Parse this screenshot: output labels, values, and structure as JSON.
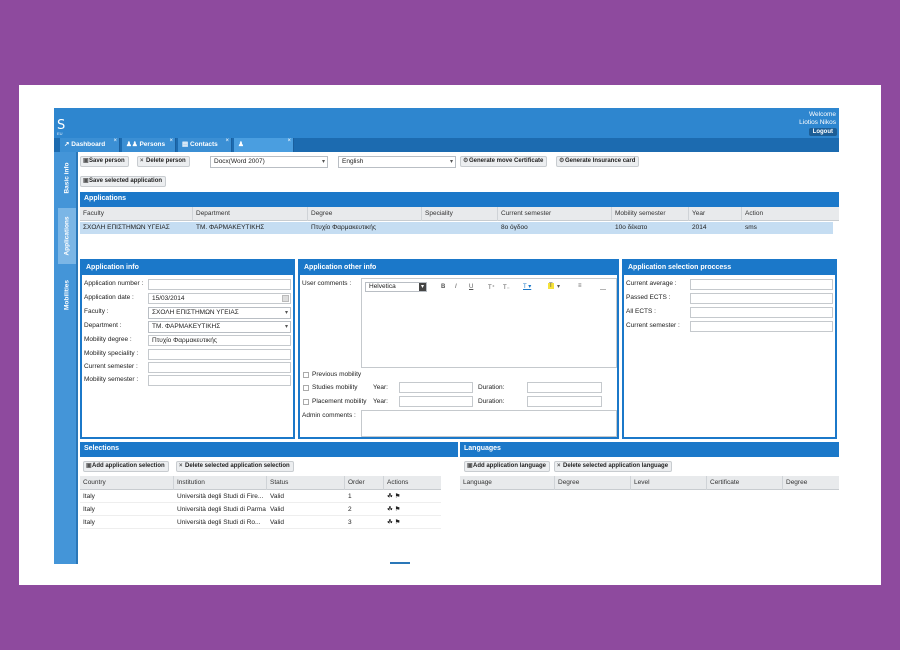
{
  "header": {
    "logo": "S",
    "logo_sub": "EU",
    "welcome": "Welcome",
    "user_name": "Liotios Nikos",
    "logout_label": "Logout"
  },
  "tabs": [
    {
      "label": "Dashboard",
      "icon": "chart-icon"
    },
    {
      "label": "Persons",
      "icon": "users-icon"
    },
    {
      "label": "Contacts",
      "icon": "contacts-icon"
    },
    {
      "label": "",
      "icon": "user-icon"
    }
  ],
  "sidenav": {
    "items": [
      "Basic info",
      "Applications",
      "Mobilities"
    ]
  },
  "toolbar": {
    "save_person": "Save person",
    "delete_person": "Delete person",
    "format_value": "Docx(Word 2007)",
    "language_value": "English",
    "gen_move_cert": "Generate move Certificate",
    "gen_insurance": "Generate Insurance card",
    "save_selected_application": "Save selected application"
  },
  "applications": {
    "title": "Applications",
    "columns": [
      "Faculty",
      "Department",
      "Degree",
      "Speciality",
      "Current semester",
      "Mobility semester",
      "Year",
      "Action"
    ],
    "rows": [
      [
        "ΣΧΟΛΗ ΕΠΙΣΤΗΜΩΝ ΥΓΕΙΑΣ",
        "ΤΜ. ΦΑΡΜΑΚΕΥΤΙΚΗΣ",
        "Πτυχίο Φαρμακευτικής",
        "",
        "8ο όγδοο",
        "10ο δέκατο",
        "2014",
        "sms"
      ]
    ]
  },
  "app_info": {
    "title": "Application info",
    "labels": {
      "number": "Application number :",
      "date": "Application date :",
      "faculty": "Faculty :",
      "department": "Department :",
      "mobility_degree": "Mobility degree :",
      "mobility_speciality": "Mobility speciality :",
      "current_semester": "Current semester :",
      "mobility_semester": "Mobility semester :"
    },
    "values": {
      "number": "",
      "date": "15/03/2014",
      "faculty": "ΣΧΟΛΗ ΕΠΙΣΤΗΜΩΝ ΥΓΕΙΑΣ",
      "department": "ΤΜ. ΦΑΡΜΑΚΕΥΤΙΚΗΣ",
      "mobility_degree": "Πτυχίο Φαρμακευτικής",
      "mobility_speciality": "",
      "current_semester": "",
      "mobility_semester": ""
    }
  },
  "other_info": {
    "title": "Application other info",
    "user_comments": "User comments :",
    "font_value": "Helvetica",
    "previous_mobility": "Previous mobility",
    "studies_mobility": "Studies mobility",
    "placement_mobility": "Placement mobility",
    "year_label": "Year:",
    "duration_label": "Duration:",
    "admin_comments": "Admin comments :"
  },
  "selection_process": {
    "title": "Application selection proccess",
    "current_average": "Current average :",
    "passed_ects": "Passed ECTS :",
    "all_ects": "All ECTS :",
    "current_semester": "Current semester :"
  },
  "selections": {
    "title": "Selections",
    "add_label": "Add application selection",
    "delete_label": "Delete selected application selection",
    "columns": [
      "Country",
      "Institution",
      "Status",
      "Order",
      "Actions"
    ],
    "rows": [
      [
        "Italy",
        "Università degli Studi di Fire...",
        "Valid",
        "1"
      ],
      [
        "Italy",
        "Università degli Studi di Parma",
        "Valid",
        "2"
      ],
      [
        "Italy",
        "Università degli Studi di Ro...",
        "Valid",
        "3"
      ]
    ]
  },
  "languages": {
    "title": "Languages",
    "add_label": "Add application language",
    "delete_label": "Delete selected application language",
    "columns": [
      "Language",
      "Degree",
      "Level",
      "Certificate",
      "Degree"
    ]
  },
  "colors": {
    "accent": "#1b78c9",
    "background": "#8e4a9e",
    "selected_row": "#c5ddf2"
  }
}
